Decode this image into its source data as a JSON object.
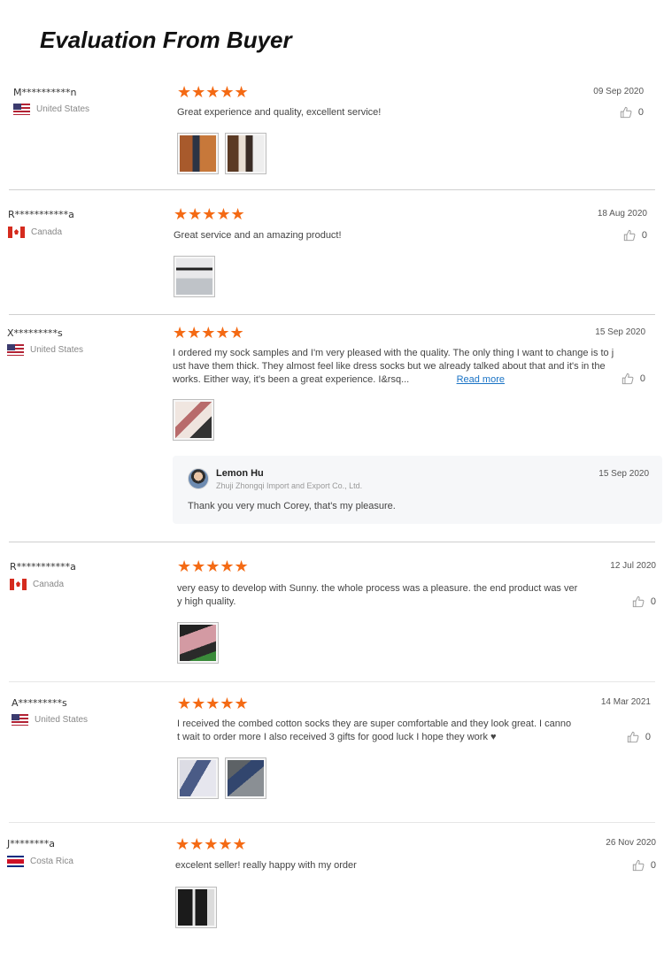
{
  "page_title": "Evaluation From Buyer",
  "stars_glyph": "★★★★★",
  "reviews": [
    {
      "buyer": "M**********n",
      "country": "United States",
      "date": "09 Sep 2020",
      "comment": "Great experience and quality, excellent service!",
      "likes": "0"
    },
    {
      "buyer": "R***********a",
      "country": "Canada",
      "date": "18 Aug 2020",
      "comment": "Great service and an amazing product!",
      "likes": "0"
    },
    {
      "buyer": "X*********s",
      "country": "United States",
      "date": "15 Sep 2020",
      "comment_line1": "I ordered my sock samples and I'm very pleased with the quality. The only thing I want to change is to j",
      "comment_line2": "ust have them thick. They almost feel like dress socks but we already talked about that and it's in the",
      "comment_line3": "works. Either way, it's been a great experience. I&rsq...",
      "read_more": "Read more",
      "likes": "0",
      "reply": {
        "name": "Lemon Hu",
        "company": "Zhuji Zhongqi Import and Export Co., Ltd.",
        "date": "15 Sep 2020",
        "text": "Thank you very much Corey, that's my pleasure."
      }
    },
    {
      "buyer": "R***********a",
      "country": "Canada",
      "date": "12 Jul 2020",
      "comment_line1": "very easy to develop with Sunny. the whole process was a pleasure. the end product was ver",
      "comment_line2": "y high quality.",
      "likes": "0"
    },
    {
      "buyer": "A*********s",
      "country": "United States",
      "date": "14 Mar 2021",
      "comment_line1": "I received the combed cotton socks they are super comfortable and they look great. I canno",
      "comment_line2": "t wait to order more I also received 3 gifts for good luck I hope they work ♥",
      "likes": "0"
    },
    {
      "buyer": "J********a",
      "country": "Costa Rica",
      "date": "26 Nov 2020",
      "comment": "excelent seller! really happy with my order",
      "likes": "0"
    }
  ],
  "colors": {
    "star": "#f46a14",
    "link": "#1a73c5",
    "divider": "#cfcfcf"
  },
  "icons": {
    "like": "thumbs-up-icon",
    "star": "star-icon"
  }
}
